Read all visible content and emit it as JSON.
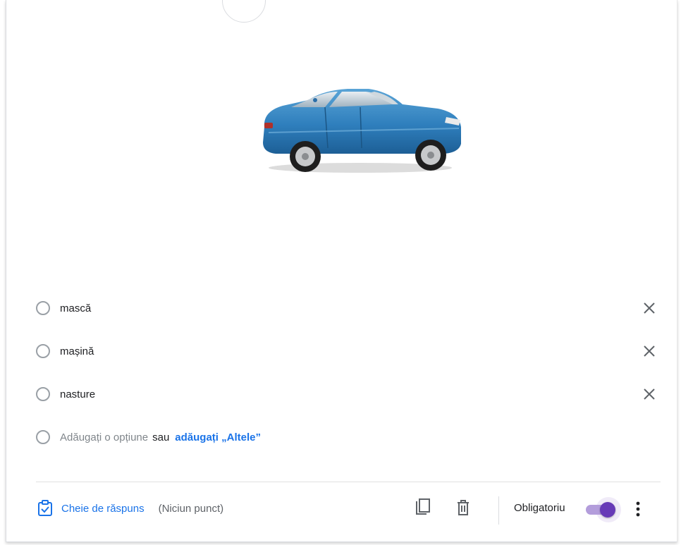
{
  "question": {
    "image_alt": "blue car",
    "options": [
      {
        "label": "mască"
      },
      {
        "label": "mașină"
      },
      {
        "label": "nasture"
      }
    ],
    "add_option": {
      "placeholder": "Adăugați o opțiune",
      "or_text": "sau",
      "add_other_link": "adăugați „Altele”"
    }
  },
  "footer": {
    "answer_key_label": "Cheie de răspuns",
    "points_label": "(Niciun punct)",
    "required_label": "Obligatoriu",
    "required_on": true
  },
  "colors": {
    "accent_purple": "#673ab7",
    "link_blue": "#1a73e8",
    "icon_gray": "#5f6368"
  },
  "icons": [
    "answer-key-icon",
    "remove-option-x-icon",
    "duplicate-icon",
    "delete-icon",
    "more-vert-icon"
  ]
}
